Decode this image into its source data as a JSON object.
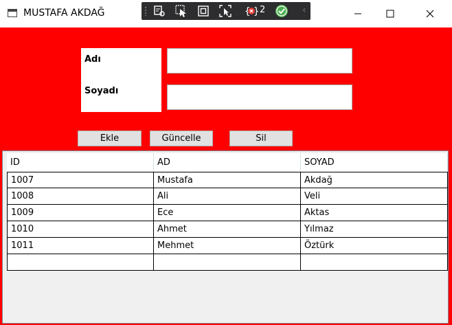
{
  "window": {
    "title": "MUSTAFA AKDAĞ"
  },
  "debug_toolbar": {
    "icons": [
      "live-visual-tree-icon",
      "select-element-icon",
      "display-layout-adorners-icon",
      "track-focus-icon",
      "binding-failures-icon",
      "hot-reload-ok-icon"
    ],
    "binding_failures_count": "2"
  },
  "form": {
    "label_ad": "Adı",
    "label_soyad": "Soyadı",
    "input_ad_value": "",
    "input_soyad_value": ""
  },
  "buttons": {
    "ekle": "Ekle",
    "guncelle": "Güncelle",
    "sil": "Sil"
  },
  "grid": {
    "columns": [
      "ID",
      "AD",
      "SOYAD"
    ],
    "rows": [
      [
        "1007",
        "Mustafa",
        "Akdağ"
      ],
      [
        "1008",
        "Ali",
        "Veli"
      ],
      [
        "1009",
        "Ece",
        "Aktas"
      ],
      [
        "1010",
        "Ahmet",
        "Yılmaz"
      ],
      [
        "1011",
        "Mehmet",
        "Öztürk"
      ],
      [
        "",
        "",
        ""
      ]
    ]
  },
  "colors": {
    "background": "#ff0000",
    "debug_toolbar": "#2d2d30",
    "ok_check": "#4caf50",
    "error_badge": "#e53935"
  }
}
